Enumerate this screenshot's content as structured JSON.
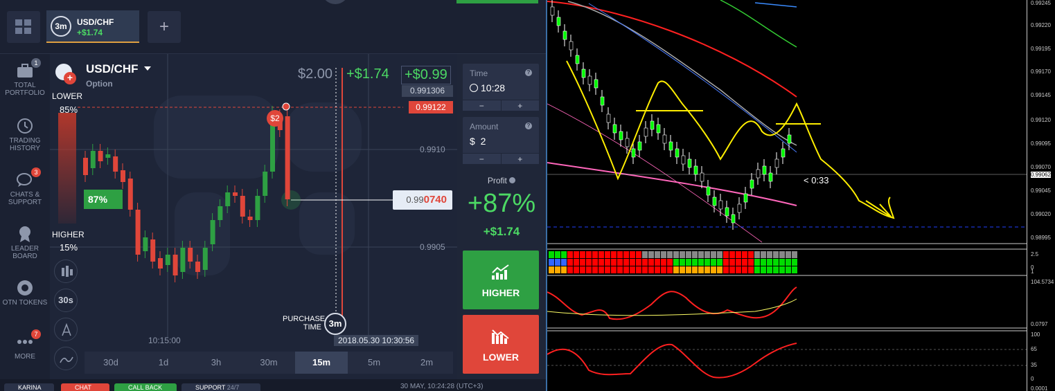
{
  "topbar": {
    "asset_tab": {
      "timer": "3m",
      "name": "USD/CHF",
      "profit": "+$1.74"
    },
    "add_label": "+"
  },
  "sidebar": {
    "items": [
      {
        "label": "TOTAL PORTFOLIO",
        "badge": "1",
        "icon": "briefcase-icon"
      },
      {
        "label": "TRADING HISTORY",
        "icon": "history-icon"
      },
      {
        "label": "CHATS & SUPPORT",
        "badge": "3",
        "icon": "chat-icon"
      },
      {
        "label": "LEADER BOARD",
        "icon": "trophy-icon"
      },
      {
        "label": "OTN TOKENS",
        "icon": "token-icon"
      },
      {
        "label": "MORE",
        "badge": "7",
        "icon": "more-icon"
      }
    ]
  },
  "chart": {
    "asset": "USD/CHF",
    "asset_type": "Option",
    "investment": "$2.00",
    "profit_now": "+$1.74",
    "profit_box": "+$0.99",
    "lower_label": "LOWER",
    "lower_pct": "85%",
    "higher_label": "HIGHER",
    "higher_pct": "15%",
    "side_pct": "87%",
    "price_top": "0.991306",
    "price_entry": "0.99122",
    "grid_price_1": "0.9910",
    "grid_price_2": "0.9905",
    "current_price_prefix": "0.99",
    "current_price_suffix": "0740",
    "deal_marker": "$2",
    "purchase_label_1": "PURCHASE",
    "purchase_label_2": "TIME",
    "purchase_timer": "3m",
    "datetime": "2018.05.30 10:30:56",
    "time_tick": "10:15:00",
    "tools": [
      "candles-icon",
      "30s",
      "draw-icon",
      "indicator-icon"
    ],
    "timeframes": [
      "30d",
      "1d",
      "3h",
      "30m",
      "15m",
      "5m",
      "2m"
    ],
    "selected_timeframe": "15m"
  },
  "trade_panel": {
    "time_label": "Time",
    "time_value": "10:28",
    "amount_label": "Amount",
    "amount_currency": "$",
    "amount_value": "2",
    "minus": "−",
    "plus": "+",
    "profit_label": "Profit",
    "profit_pct": "+87%",
    "profit_amount": "+$1.74",
    "higher_button": "HIGHER",
    "lower_button": "LOWER"
  },
  "bottombar": {
    "user": "KARINA",
    "chat": "CHAT",
    "callback": "CALL BACK",
    "support": "SUPPORT",
    "support_hours": "24/7",
    "clock": "30 MAY, 10:24:28 (UTC+3)"
  },
  "mt4": {
    "prices": [
      "0.99245",
      "0.99220",
      "0.99195",
      "0.99170",
      "0.99145",
      "0.99120",
      "0.99095",
      "0.99070",
      "0.99062",
      "0.99045",
      "0.99020",
      "0.98995"
    ],
    "countdown": "< 0:33",
    "osc1_levels": [
      "2.5",
      "0",
      "1"
    ],
    "osc2_top": "104.5734",
    "osc2_bottom": "0.0797",
    "osc3_levels": [
      "100",
      "65",
      "35",
      "0"
    ],
    "osc3_bottom": "0.0001"
  },
  "colors": {
    "green": "#2ea043",
    "red": "#e0463a",
    "profit_green": "#4cd964"
  }
}
